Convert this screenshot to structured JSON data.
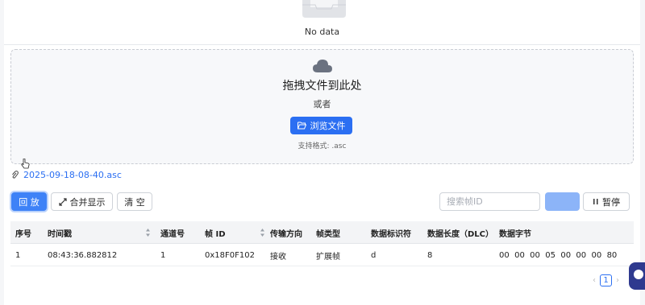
{
  "empty_state": {
    "text": "No data"
  },
  "dropzone": {
    "title": "拖拽文件到此处",
    "or_text": "或者",
    "browse_label": "浏览文件",
    "hint": "支持格式: .asc"
  },
  "file": {
    "name": "2025-09-18-08-40.asc"
  },
  "toolbar": {
    "play_label": "回 放",
    "merge_label": "合并显示",
    "clear_label": "清 空",
    "search_placeholder": "搜索帧ID",
    "pause_label": "暂停"
  },
  "table": {
    "headers": [
      "序号",
      "时间戳",
      "通道号",
      "帧 ID",
      "传输方向",
      "帧类型",
      "数据标识符",
      "数据长度（DLC）",
      "数据字节"
    ],
    "rows": [
      [
        "1",
        "08:43:36.882812",
        "1",
        "0x18F0F102",
        "接收",
        "扩展帧",
        "d",
        "8",
        "00  00  00  05  00  00  00  80"
      ]
    ]
  },
  "pagination": {
    "current": "1"
  },
  "colors": {
    "primary": "#2b6ff2",
    "primary_light": "#8cb4f8",
    "header_bg": "#f3f4f6"
  }
}
